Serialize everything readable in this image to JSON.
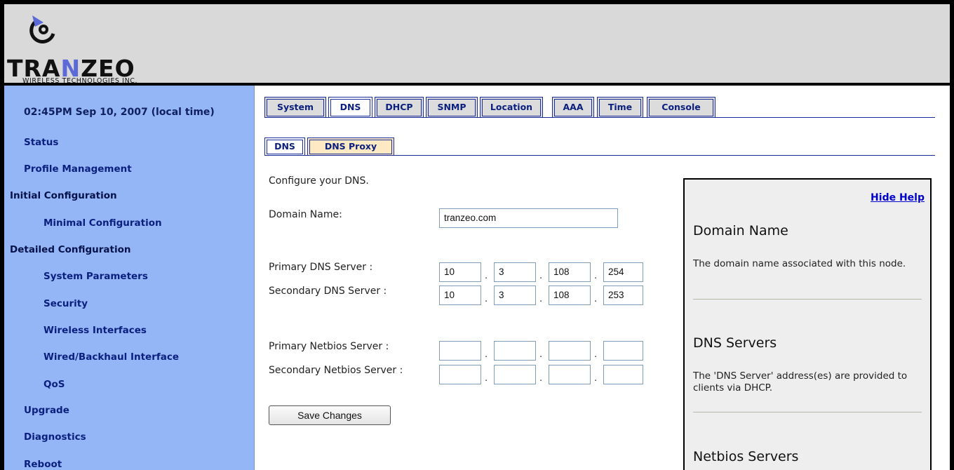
{
  "header": {
    "logo_word_a": "TRA",
    "logo_word_b": "N",
    "logo_word_c": "ZEO",
    "logo_sub": "WIRELESS TECHNOLOGIES INC."
  },
  "sidebar": {
    "clock": "02:45PM Sep 10, 2007 (local time)",
    "items": [
      {
        "label": "Status"
      },
      {
        "label": "Profile Management"
      },
      {
        "label": "Initial Configuration"
      },
      {
        "label": "Minimal Configuration"
      },
      {
        "label": "Detailed Configuration"
      },
      {
        "label": "System Parameters"
      },
      {
        "label": "Security"
      },
      {
        "label": "Wireless Interfaces"
      },
      {
        "label": "Wired/Backhaul Interface"
      },
      {
        "label": "QoS"
      },
      {
        "label": "Upgrade"
      },
      {
        "label": "Diagnostics"
      },
      {
        "label": "Reboot"
      }
    ]
  },
  "tabs": [
    {
      "label": "System"
    },
    {
      "label": "DNS"
    },
    {
      "label": "DHCP"
    },
    {
      "label": "SNMP"
    },
    {
      "label": "Location"
    },
    {
      "label": "AAA"
    },
    {
      "label": "Time"
    },
    {
      "label": "Console"
    }
  ],
  "subtabs": [
    {
      "label": "DNS"
    },
    {
      "label": "DNS Proxy"
    }
  ],
  "form": {
    "intro": "Configure your DNS.",
    "domain_label": "Domain Name:",
    "domain_value": "tranzeo.com",
    "primary_dns_label": "Primary DNS Server :",
    "primary_dns": [
      "10",
      "3",
      "108",
      "254"
    ],
    "secondary_dns_label": "Secondary DNS Server :",
    "secondary_dns": [
      "10",
      "3",
      "108",
      "253"
    ],
    "primary_netbios_label": "Primary Netbios Server :",
    "primary_netbios": [
      "",
      "",
      "",
      ""
    ],
    "secondary_netbios_label": "Secondary Netbios Server :",
    "secondary_netbios": [
      "",
      "",
      "",
      ""
    ],
    "dot": ".",
    "save_label": "Save Changes"
  },
  "help": {
    "hide_label": "Hide Help",
    "sections": [
      {
        "title": "Domain Name",
        "text": "The domain name associated with this node."
      },
      {
        "title": "DNS Servers",
        "text": "The 'DNS Server' address(es) are provided to clients via DHCP."
      },
      {
        "title": "Netbios Servers",
        "text": ""
      }
    ]
  },
  "colors": {
    "sidebar_bg": "#94b6f6",
    "header_bg": "#d9d9d9",
    "tab_border": "#1a2c9a",
    "link": "#0000cc"
  }
}
